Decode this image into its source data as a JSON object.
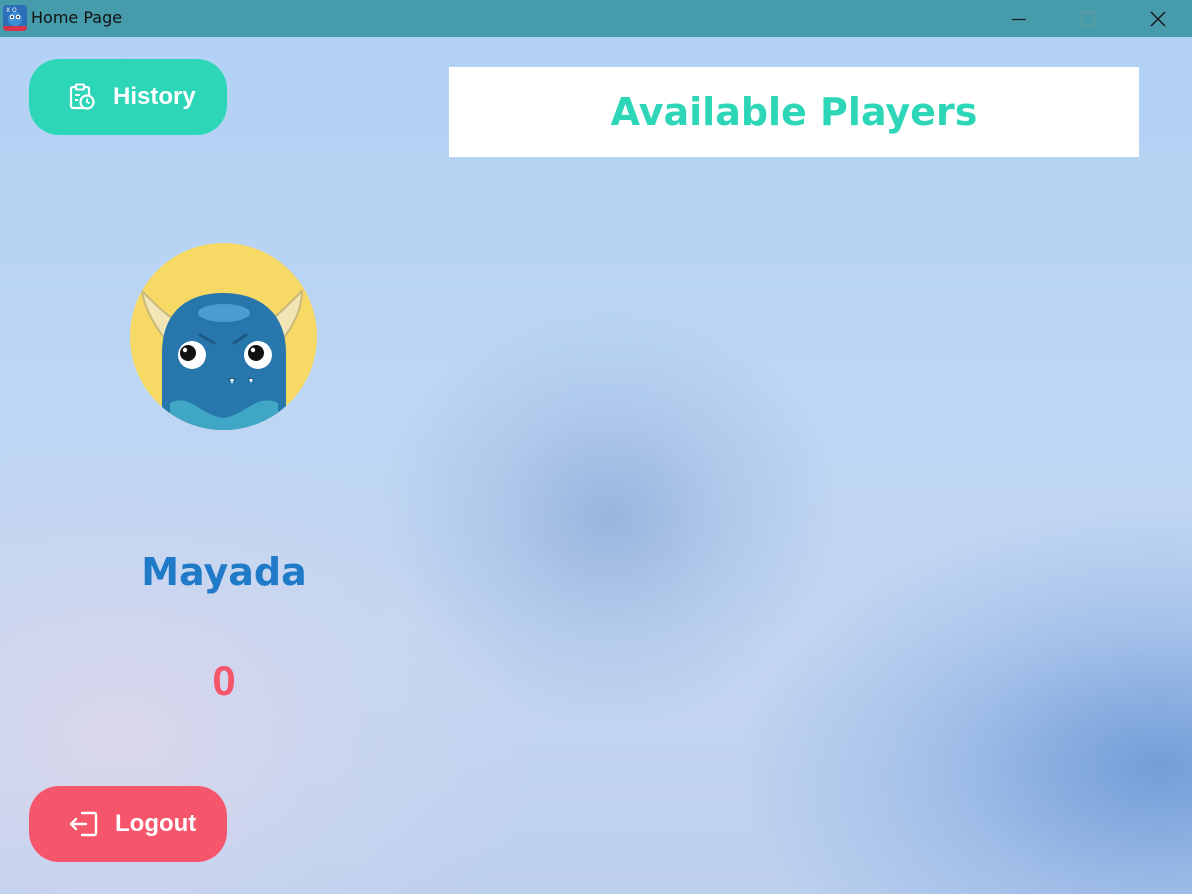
{
  "window": {
    "title": "Home Page",
    "icon": "app-monster-icon"
  },
  "titlebar_controls": {
    "minimize_icon": "minimize-icon",
    "maximize_icon": "maximize-icon",
    "close_icon": "close-icon"
  },
  "sidebar": {
    "history_button": {
      "label": "History",
      "icon": "clipboard-clock-icon"
    },
    "avatar": {
      "icon": "blue-monster-avatar"
    },
    "username": "Mayada",
    "score": "0",
    "logout_button": {
      "label": "Logout",
      "icon": "logout-icon"
    }
  },
  "main": {
    "players_header": "Available Players",
    "players": []
  },
  "colors": {
    "titlebar": "#479cab",
    "accent_teal": "#2cd6b6",
    "accent_red": "#f6566b",
    "username_blue": "#1f7ac8"
  }
}
